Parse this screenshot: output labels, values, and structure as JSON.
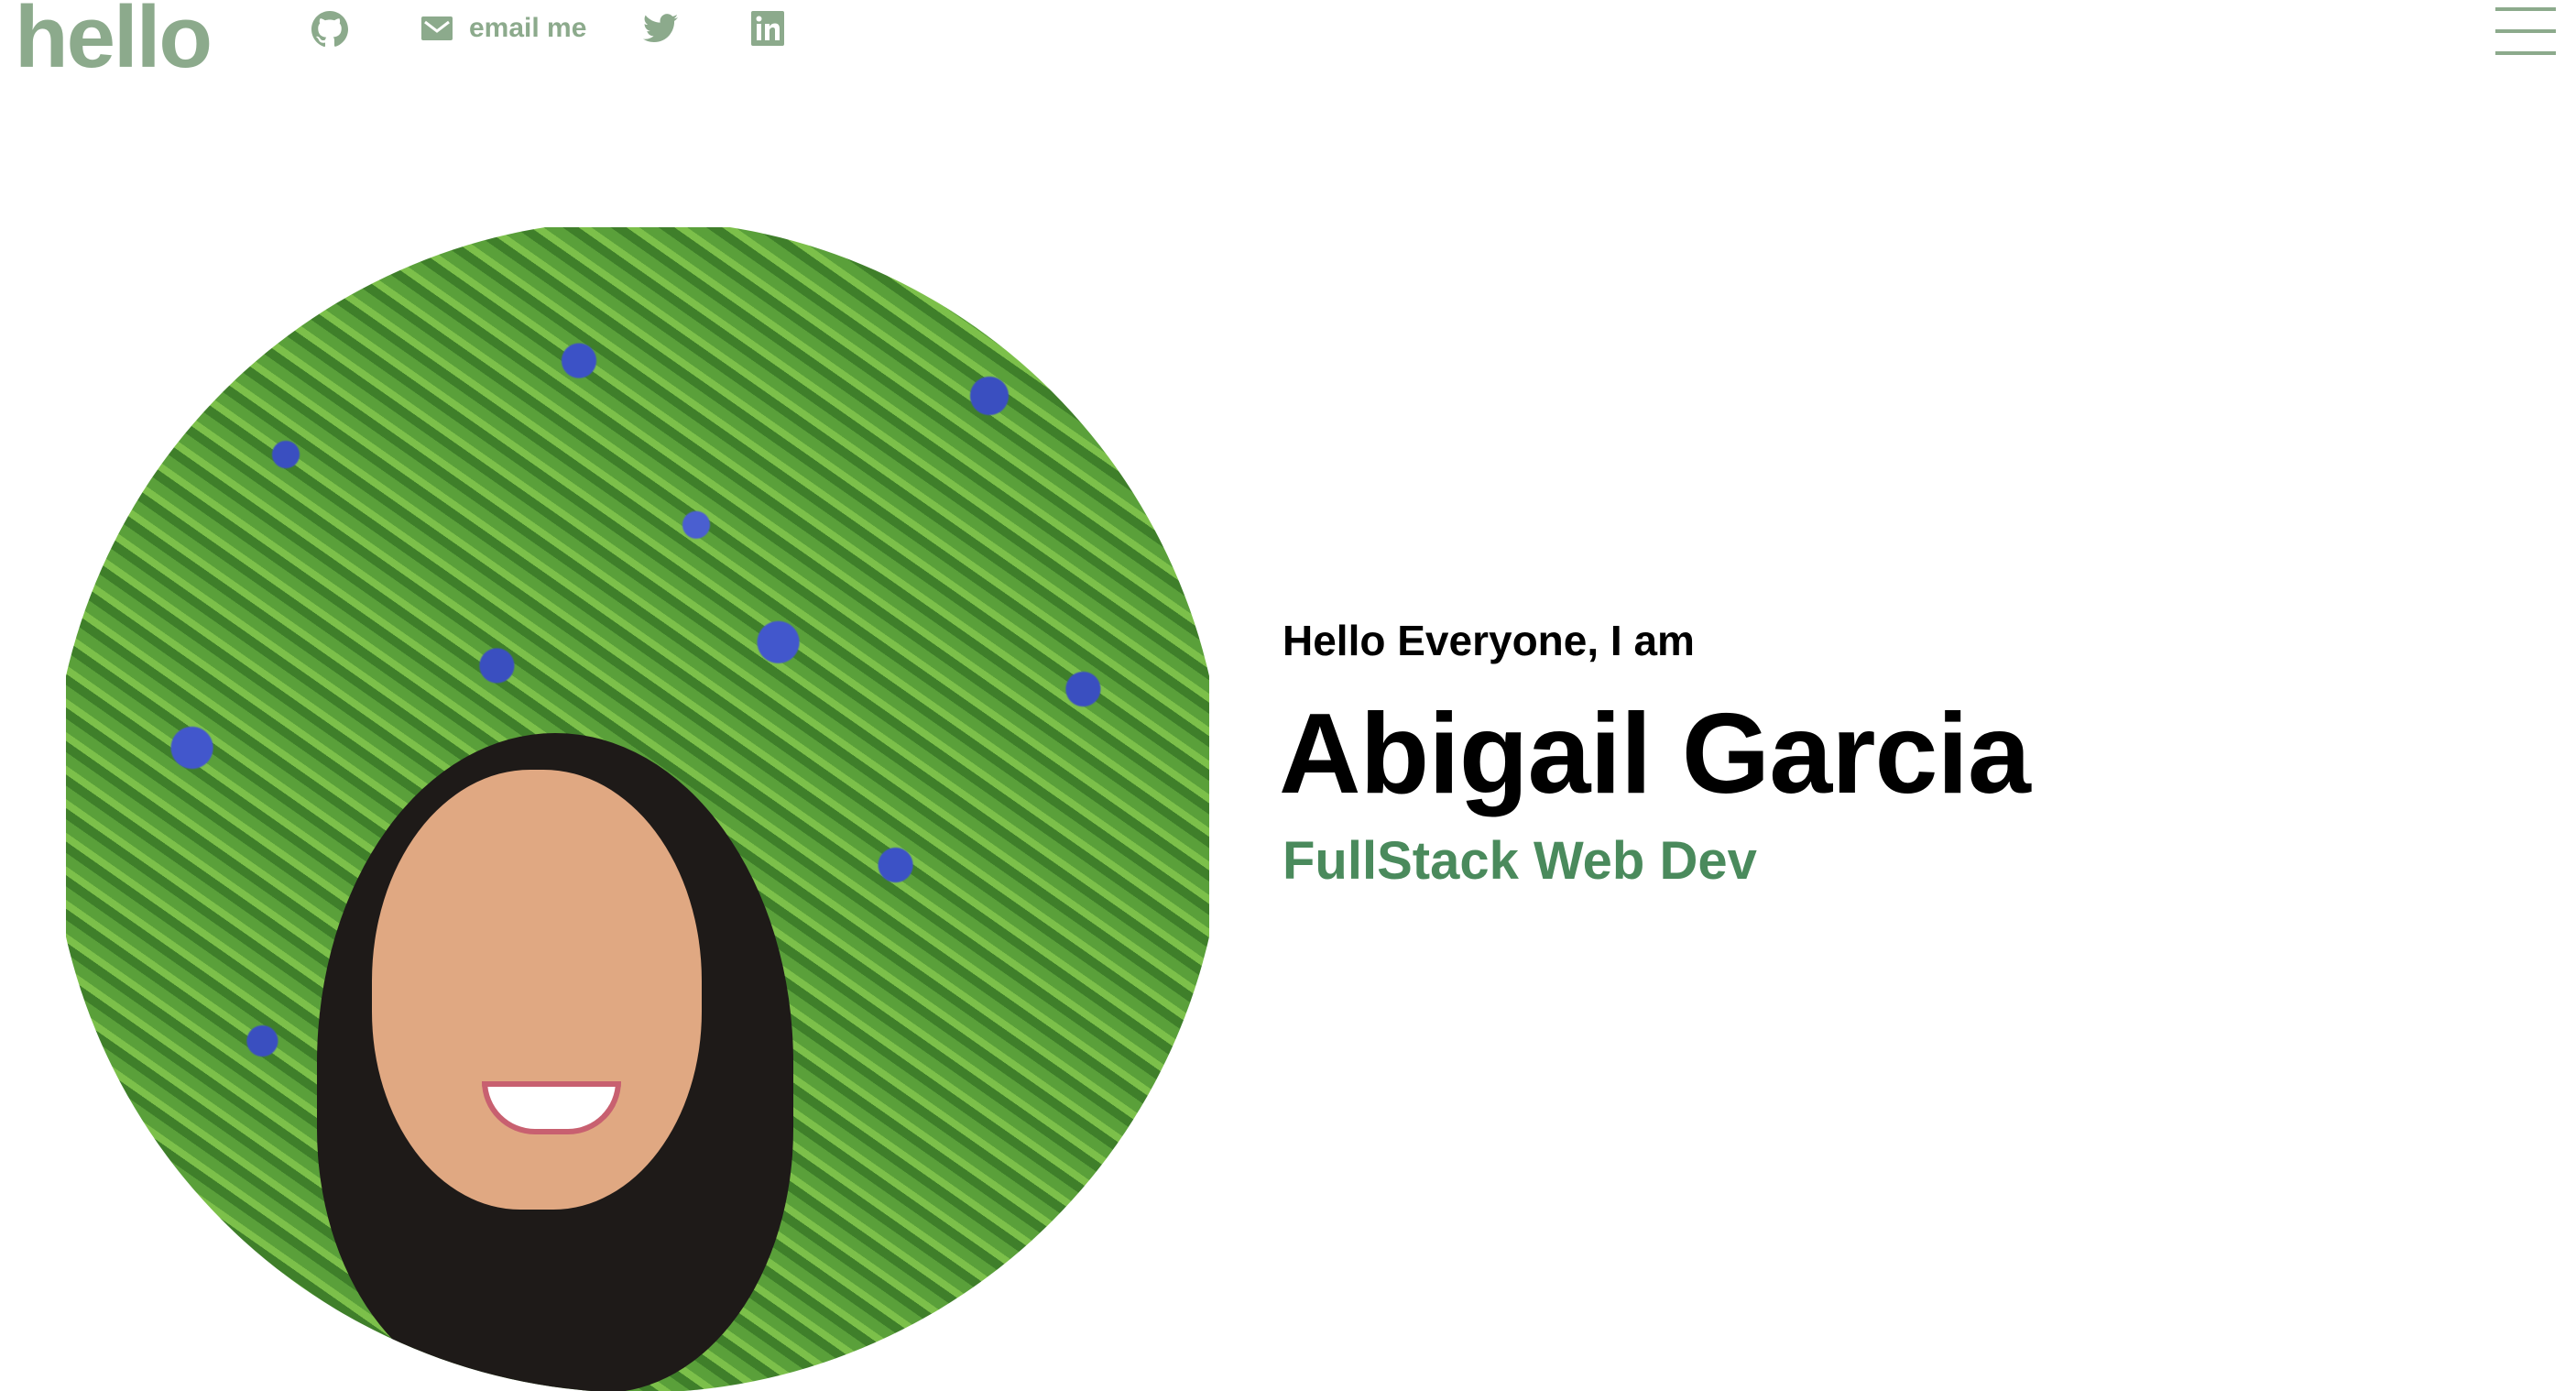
{
  "header": {
    "logo": "hello",
    "links": [
      {
        "icon": "github-icon"
      },
      {
        "icon": "mail-icon",
        "label": "email me"
      },
      {
        "icon": "twitter-icon"
      },
      {
        "icon": "linkedin-icon"
      }
    ],
    "menu_icon": "hamburger-menu-icon"
  },
  "hero": {
    "intro": "Hello Everyone, I am",
    "name": "Abigail Garcia",
    "role": "FullStack Web Dev"
  },
  "colors": {
    "nav": "#8caa8c",
    "accent": "#4a8a5c",
    "text": "#000000"
  }
}
